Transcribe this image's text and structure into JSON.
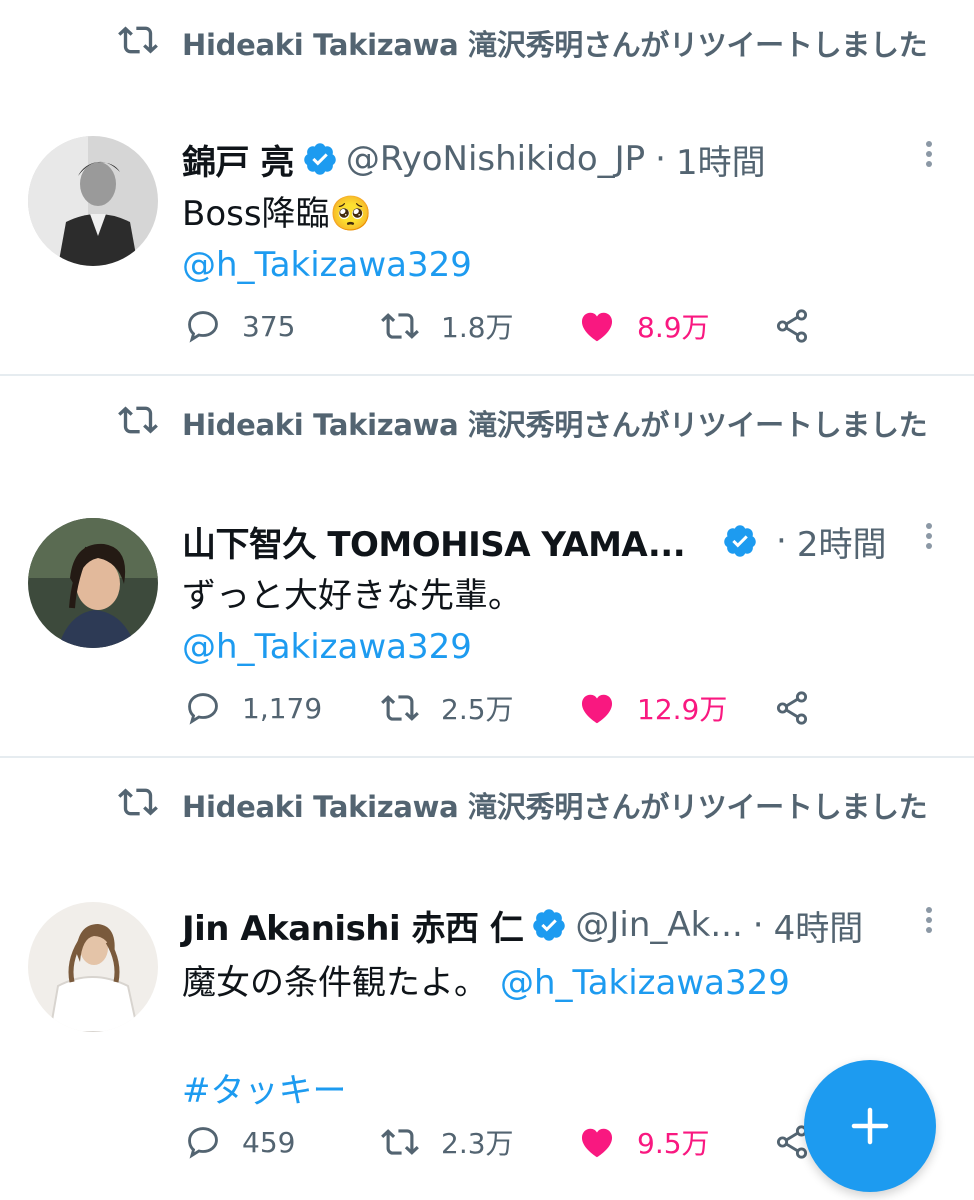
{
  "retweet_label": "Hideaki Takizawa 滝沢秀明さんがリツイートしました",
  "colors": {
    "accent": "#1d9bf0",
    "like": "#f91880",
    "muted": "#536471",
    "divider": "#e6ecf0"
  },
  "tweets": [
    {
      "name": "錦戸 亮",
      "handle": "@RyoNishikido_JP",
      "time": "1時間",
      "dot": "·",
      "text": "Boss降臨🥺",
      "mention": "@h_Takizawa329",
      "replies": "375",
      "retweets": "1.8万",
      "likes": "8.9万"
    },
    {
      "name": "山下智久 TOMOHISA YAMA...",
      "handle": "",
      "time": "2時間",
      "dot": "·",
      "text": "ずっと大好きな先輩。",
      "mention": "@h_Takizawa329",
      "replies": "1,179",
      "retweets": "2.5万",
      "likes": "12.9万"
    },
    {
      "name": "Jin Akanishi  赤西 仁",
      "handle": "@Jin_Ak...",
      "time": "4時間",
      "dot": "·",
      "text": "魔女の条件観たよ。",
      "mention": "@h_Takizawa329",
      "hashtag": "#タッキー",
      "replies": "459",
      "retweets": "2.3万",
      "likes": "9.5万"
    }
  ],
  "icons": [
    "retweet-icon",
    "verified-badge-icon",
    "more-options-icon",
    "reply-icon",
    "like-heart-icon",
    "share-icon",
    "compose-plus-icon"
  ]
}
